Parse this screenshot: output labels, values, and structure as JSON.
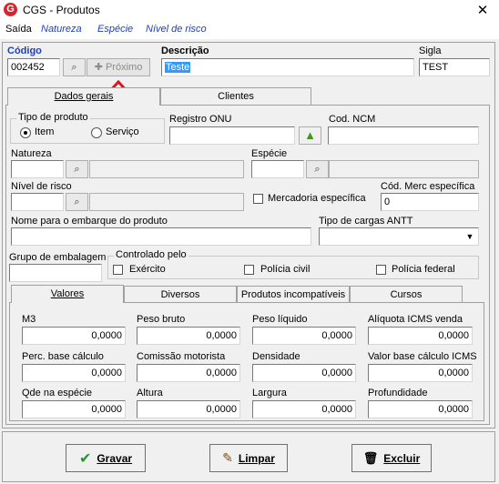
{
  "window": {
    "title": "CGS - Produtos",
    "app_icon_letter": "G",
    "close": "✕"
  },
  "menu": [
    {
      "label": "Saída"
    },
    {
      "label": "Natureza"
    },
    {
      "label": "Espécie"
    },
    {
      "label": "Nível de risco"
    }
  ],
  "header": {
    "codigo_label": "Código",
    "codigo_value": "002452",
    "proximo_label": "Próximo",
    "descricao_label": "Descrição",
    "descricao_value": "Teste",
    "sigla_label": "Sigla",
    "sigla_value": "TEST"
  },
  "tabs_main": [
    {
      "label": "Dados gerais",
      "active": true
    },
    {
      "label": "Clientes",
      "active": false
    }
  ],
  "dados": {
    "tipo_produto_label": "Tipo de produto",
    "tipo_produto_options": [
      "Item",
      "Serviço"
    ],
    "tipo_produto_selected": "Item",
    "registro_onu_label": "Registro ONU",
    "cod_ncm_label": "Cod. NCM",
    "natureza_label": "Natureza",
    "especie_label": "Espécie",
    "nivel_risco_label": "Nível de risco",
    "mercadoria_especifica_label": "Mercadoria específica",
    "cod_merc_label": "Cód. Merc específica",
    "cod_merc_value": "0",
    "nome_embarque_label": "Nome para o embarque do produto",
    "tipo_cargas_label": "Tipo de cargas ANTT",
    "grupo_embalagem_label": "Grupo de embalagem",
    "controlado_label": "Controlado pelo",
    "controlado_options": [
      "Exército",
      "Polícia civil",
      "Polícia federal"
    ]
  },
  "tabs_sub": [
    {
      "label": "Valores",
      "active": true
    },
    {
      "label": "Diversos",
      "active": false
    },
    {
      "label": "Produtos incompatíveis",
      "active": false
    },
    {
      "label": "Cursos",
      "active": false
    }
  ],
  "valores": {
    "row1": [
      {
        "label": "M3",
        "value": "0,0000"
      },
      {
        "label": "Peso bruto",
        "value": "0,0000"
      },
      {
        "label": "Peso líquido",
        "value": "0,0000"
      },
      {
        "label": "Alíquota ICMS venda",
        "value": "0,0000"
      }
    ],
    "row2": [
      {
        "label": "Perc. base cálculo",
        "value": "0,0000"
      },
      {
        "label": "Comissão motorista",
        "value": "0,0000"
      },
      {
        "label": "Densidade",
        "value": "0,0000"
      },
      {
        "label": "Valor base cálculo ICMS",
        "value": "0,0000"
      }
    ],
    "row3": [
      {
        "label": "Qde na espécie",
        "value": "0,0000"
      },
      {
        "label": "Altura",
        "value": "0,0000"
      },
      {
        "label": "Largura",
        "value": "0,0000"
      },
      {
        "label": "Profundidade",
        "value": "0,0000"
      }
    ]
  },
  "footer": {
    "gravar_label": "Gravar",
    "limpar_label": "Limpar",
    "excluir_label": "Excluir"
  },
  "colors": {
    "accent_blue": "#1a3ec8",
    "selection": "#3399ff",
    "arrow_red": "#e0141c"
  }
}
